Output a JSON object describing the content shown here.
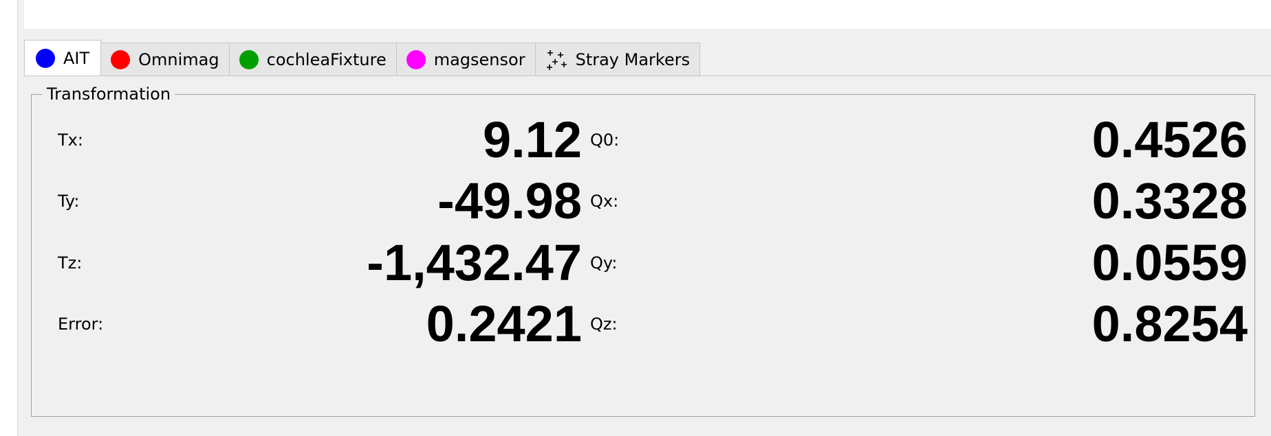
{
  "tabs": [
    {
      "label": "AIT",
      "color": "#0000ff",
      "icon": "blue-dot-icon",
      "active": true
    },
    {
      "label": "Omnimag",
      "color": "#ff0000",
      "icon": "red-dot-icon",
      "active": false
    },
    {
      "label": "cochleaFixture",
      "color": "#00a000",
      "icon": "green-dot-icon",
      "active": false
    },
    {
      "label": "magsensor",
      "color": "#ff00ff",
      "icon": "magenta-dot-icon",
      "active": false
    },
    {
      "label": "Stray Markers",
      "icon": "sparkle-markers-icon",
      "active": false
    }
  ],
  "transformation": {
    "title": "Transformation",
    "rows": [
      {
        "left_label": "Tx:",
        "left_value": "9.12",
        "right_label": "Q0:",
        "right_value": "0.4526"
      },
      {
        "left_label": "Ty:",
        "left_value": "-49.98",
        "right_label": "Qx:",
        "right_value": "0.3328"
      },
      {
        "left_label": "Tz:",
        "left_value": "-1,432.47",
        "right_label": "Qy:",
        "right_value": "0.0559"
      },
      {
        "left_label": "Error:",
        "left_value": "0.2421",
        "right_label": "Qz:",
        "right_value": "0.8254"
      }
    ]
  }
}
